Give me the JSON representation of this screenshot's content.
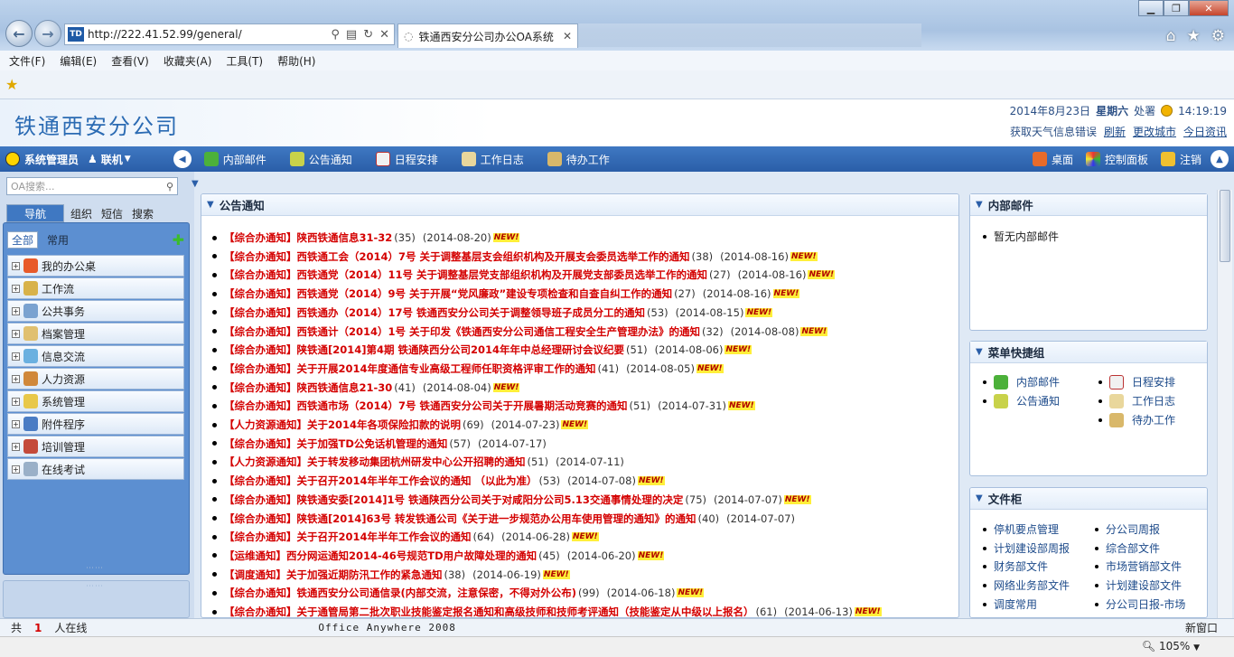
{
  "browser": {
    "url": "http://222.41.52.99/general/",
    "tab_title": "铁通西安分公司办公OA系统",
    "favicon_text": "TD",
    "zoom": "105%",
    "menu": [
      "文件(F)",
      "编辑(E)",
      "查看(V)",
      "收藏夹(A)",
      "工具(T)",
      "帮助(H)"
    ]
  },
  "header": {
    "logo": "铁通西安分公司",
    "date": "2014年8月23日",
    "weekday": "星期六",
    "role": "处署",
    "time": "14:19:19",
    "weather_error": "获取天气信息错误",
    "refresh": "刷新",
    "change_city": "更改城市",
    "today_news": "今日资讯"
  },
  "toolbar": {
    "user": "系统管理员",
    "status": "联机",
    "items": [
      "内部邮件",
      "公告通知",
      "日程安排",
      "工作日志",
      "待办工作"
    ],
    "right_items": [
      "桌面",
      "控制面板",
      "注销"
    ]
  },
  "left": {
    "search_placeholder": "OA搜索...",
    "tabs": [
      "导航",
      "组织",
      "短信",
      "搜索"
    ],
    "filter_all": "全部",
    "filter_common": "常用",
    "nav": [
      "我的办公桌",
      "工作流",
      "公共事务",
      "档案管理",
      "信息交流",
      "人力资源",
      "系统管理",
      "附件程序",
      "培训管理",
      "在线考试"
    ]
  },
  "notices": {
    "title": "公告通知",
    "new_badge": "NEW!",
    "items": [
      {
        "t": "【综合办通知】陕西铁通信息31-32",
        "c": "(35)",
        "d": "(2014-08-20)",
        "n": true
      },
      {
        "t": "【综合办通知】西铁通工会（2014）7号 关于调整基层支会组织机构及开展支会委员选举工作的通知",
        "c": "(38)",
        "d": "(2014-08-16)",
        "n": true
      },
      {
        "t": "【综合办通知】西铁通党（2014）11号 关于调整基层党支部组织机构及开展党支部委员选举工作的通知",
        "c": "(27)",
        "d": "(2014-08-16)",
        "n": true
      },
      {
        "t": "【综合办通知】西铁通党（2014）9号 关于开展“党风廉政”建设专项检查和自查自纠工作的通知",
        "c": "(27)",
        "d": "(2014-08-16)",
        "n": true
      },
      {
        "t": "【综合办通知】西铁通办（2014）17号 铁通西安分公司关于调整领导班子成员分工的通知",
        "c": "(53)",
        "d": "(2014-08-15)",
        "n": true
      },
      {
        "t": "【综合办通知】西铁通计（2014）1号 关于印发《铁通西安分公司通信工程安全生产管理办法》的通知",
        "c": "(32)",
        "d": "(2014-08-08)",
        "n": true
      },
      {
        "t": "【综合办通知】陕铁通[2014]第4期 铁通陕西分公司2014年年中总经理研讨会议纪要",
        "c": "(51)",
        "d": "(2014-08-06)",
        "n": true
      },
      {
        "t": "【综合办通知】关于开展2014年度通信专业高级工程师任职资格评审工作的通知",
        "c": "(41)",
        "d": "(2014-08-05)",
        "n": true
      },
      {
        "t": "【综合办通知】陕西铁通信息21-30",
        "c": "(41)",
        "d": "(2014-08-04)",
        "n": true
      },
      {
        "t": "【综合办通知】西铁通市场（2014）7号 铁通西安分公司关于开展暑期活动竞赛的通知",
        "c": "(51)",
        "d": "(2014-07-31)",
        "n": true
      },
      {
        "t": "【人力资源通知】关于2014年各项保险扣款的说明",
        "c": "(69)",
        "d": "(2014-07-23)",
        "n": true
      },
      {
        "t": "【综合办通知】关于加强TD公免话机管理的通知",
        "c": "(57)",
        "d": "(2014-07-17)",
        "n": false
      },
      {
        "t": "【人力资源通知】关于转发移动集团杭州研发中心公开招聘的通知",
        "c": "(51)",
        "d": "(2014-07-11)",
        "n": false
      },
      {
        "t": "【综合办通知】关于召开2014年半年工作会议的通知 （以此为准）",
        "c": "(53)",
        "d": "(2014-07-08)",
        "n": true
      },
      {
        "t": "【综合办通知】陕铁通安委[2014]1号 铁通陕西分公司关于对咸阳分公司5.13交通事情处理的决定",
        "c": "(75)",
        "d": "(2014-07-07)",
        "n": true
      },
      {
        "t": "【综合办通知】陕铁通[2014]63号 转发铁通公司《关于进一步规范办公用车使用管理的通知》的通知",
        "c": "(40)",
        "d": "(2014-07-07)",
        "n": false
      },
      {
        "t": "【综合办通知】关于召开2014年半年工作会议的通知",
        "c": "(64)",
        "d": "(2014-06-28)",
        "n": true
      },
      {
        "t": "【运维通知】西分网运通知2014-46号规范TD用户故障处理的通知",
        "c": "(45)",
        "d": "(2014-06-20)",
        "n": true
      },
      {
        "t": "【调度通知】关于加强近期防汛工作的紧急通知",
        "c": "(38)",
        "d": "(2014-06-19)",
        "n": true
      },
      {
        "t": "【综合办通知】铁通西安分公司通信录(内部交流，注意保密，不得对外公布)",
        "c": "(99)",
        "d": "(2014-06-18)",
        "n": true
      },
      {
        "t": "【综合办通知】关于通管局第二批次职业技能鉴定报名通知和高级技师和技师考评通知（技能鉴定从中级以上报名）",
        "c": "(61)",
        "d": "(2014-06-13)",
        "n": true
      }
    ]
  },
  "mail": {
    "title": "内部邮件",
    "empty": "暂无内部邮件"
  },
  "quickmenu": {
    "title": "菜单快捷组",
    "left": [
      "内部邮件",
      "公告通知"
    ],
    "right": [
      "日程安排",
      "工作日志",
      "待办工作"
    ]
  },
  "files": {
    "title": "文件柜",
    "left": [
      "停机要点管理",
      "计划建设部周报",
      "财务部文件",
      "网络业务部文件",
      "调度常用"
    ],
    "right": [
      "分公司周报",
      "综合部文件",
      "市场营销部文件",
      "计划建设部文件",
      "分公司日报-市场"
    ]
  },
  "status": {
    "total_prefix": "共",
    "online_count": "1",
    "online_suffix": "人在线",
    "product": "Office Anywhere 2008",
    "new_window": "新窗口"
  }
}
